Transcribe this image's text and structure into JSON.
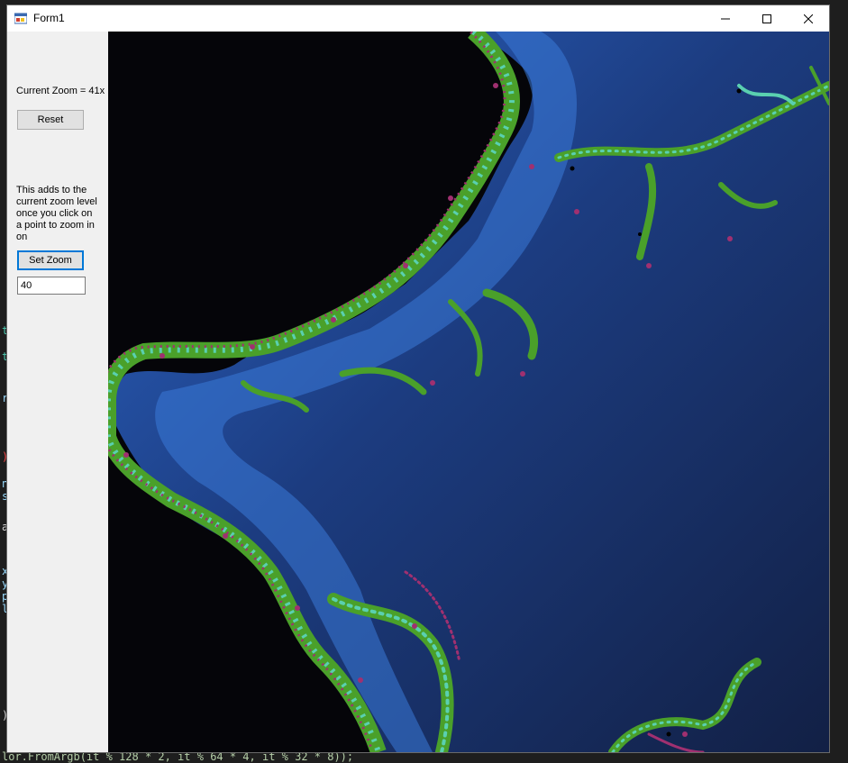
{
  "window": {
    "title": "Form1",
    "minimize_glyph": "—",
    "close_glyph": "✕"
  },
  "panel": {
    "zoom_label": "Current Zoom = 41x",
    "reset_label": "Reset",
    "help_text": "This adds to the current zoom level once you click on a point to zoom in on",
    "set_zoom_label": "Set Zoom",
    "zoom_input_value": "40"
  },
  "code_editor": {
    "bottom_line": "lor.FromArgb(it % 128 * 2, it % 64 * 4, it % 32 * 8));"
  },
  "fractal": {
    "type": "julia-set",
    "colors": {
      "background": "#050509",
      "outer_blue": "#14224a",
      "inner_blue": "#3a80e0",
      "green": "#4aa02a",
      "teal": "#5ad0b0",
      "magenta": "#a03070"
    }
  },
  "icons": [
    "form-app-icon",
    "minimize-icon",
    "maximize-icon",
    "close-icon"
  ]
}
